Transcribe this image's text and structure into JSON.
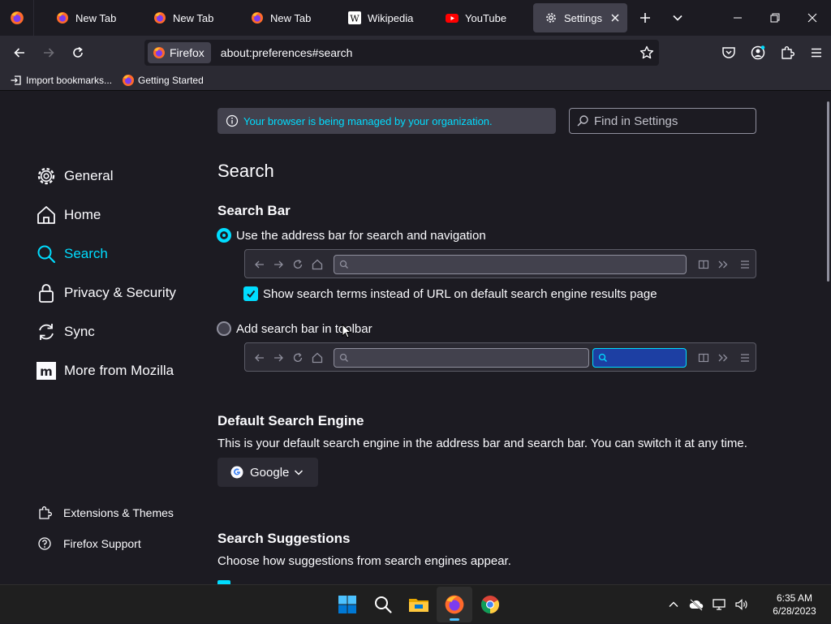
{
  "tabs": [
    {
      "title": "New Tab",
      "icon": "firefox-icon"
    },
    {
      "title": "New Tab",
      "icon": "firefox-icon"
    },
    {
      "title": "New Tab",
      "icon": "firefox-icon"
    },
    {
      "title": "Wikipedia",
      "icon": "wikipedia-icon"
    },
    {
      "title": "YouTube",
      "icon": "youtube-icon"
    },
    {
      "title": "Settings",
      "icon": "gear-icon",
      "active": true
    }
  ],
  "navbar": {
    "identity_label": "Firefox",
    "url": "about:preferences#search"
  },
  "bookmarks": [
    {
      "label": "Import bookmarks...",
      "icon": "import-icon"
    },
    {
      "label": "Getting Started",
      "icon": "firefox-icon"
    }
  ],
  "sidebar": {
    "items": [
      {
        "label": "General",
        "icon": "gear-icon"
      },
      {
        "label": "Home",
        "icon": "home-icon"
      },
      {
        "label": "Search",
        "icon": "search-icon",
        "selected": true
      },
      {
        "label": "Privacy & Security",
        "icon": "lock-icon"
      },
      {
        "label": "Sync",
        "icon": "sync-icon"
      },
      {
        "label": "More from Mozilla",
        "icon": "mozilla-icon"
      }
    ],
    "bottom": [
      {
        "label": "Extensions & Themes",
        "icon": "puzzle-icon"
      },
      {
        "label": "Firefox Support",
        "icon": "help-icon"
      }
    ]
  },
  "policy_notice": "Your browser is being managed by your organization.",
  "find_placeholder": "Find in Settings",
  "page_title": "Search",
  "search_bar": {
    "heading": "Search Bar",
    "option_address": "Use the address bar for search and navigation",
    "option_address_selected": true,
    "show_terms": "Show search terms instead of URL on default search engine results page",
    "show_terms_checked": true,
    "option_toolbar": "Add search bar in toolbar",
    "option_toolbar_selected": false
  },
  "default_engine": {
    "heading": "Default Search Engine",
    "description": "This is your default search engine in the address bar and search bar. You can switch it at any time.",
    "selected": "Google"
  },
  "suggestions": {
    "heading": "Search Suggestions",
    "description": "Choose how suggestions from search engines appear."
  },
  "taskbar": {
    "apps": [
      "windows-start-icon",
      "search-icon",
      "file-explorer-icon",
      "firefox-icon",
      "chrome-icon"
    ],
    "time": "6:35 AM",
    "date": "6/28/2023"
  },
  "colors": {
    "accent": "#00ddff",
    "background": "#1c1b22",
    "toolbar": "#2b2a33"
  }
}
